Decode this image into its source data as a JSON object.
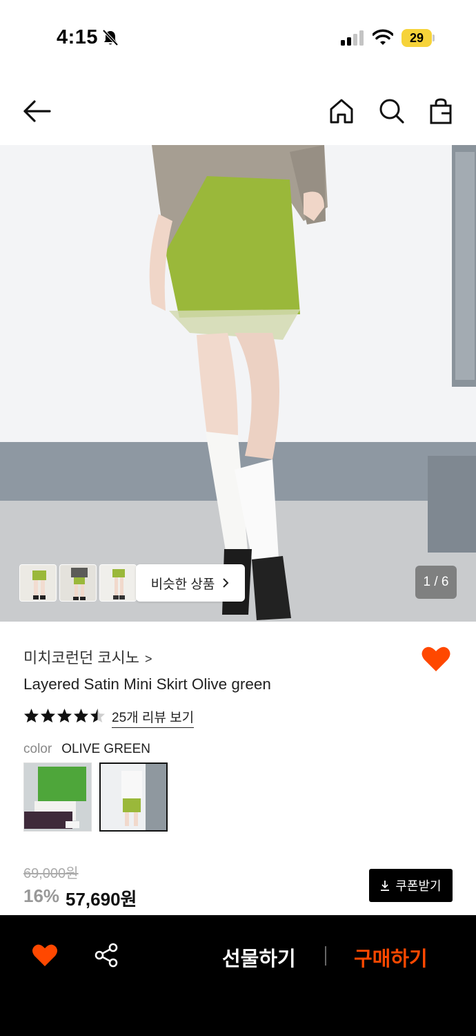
{
  "status_bar": {
    "time": "4:15",
    "battery": "29"
  },
  "nav": {
    "back": "arrow-left-icon",
    "home": "home-icon",
    "search": "search-icon",
    "bag": "shopping-bag-icon"
  },
  "gallery": {
    "similar_label": "비슷한 상품",
    "counter": "1 / 6"
  },
  "product": {
    "brand": "미치코런던 코시노",
    "brand_chevron": ">",
    "title": "Layered Satin Mini Skirt Olive green",
    "rating": 4.5,
    "review_link": "25개 리뷰 보기",
    "color_label": "color",
    "color_value": "OLIVE GREEN",
    "original_price": "69,000원",
    "discount": "16%",
    "final_price": "57,690원",
    "coupon_label": "쿠폰받기"
  },
  "bottom_bar": {
    "gift_label": "선물하기",
    "buy_label": "구매하기"
  },
  "colors": {
    "accent": "#ff4800",
    "battery": "#f6d33a",
    "skirt": "#9ab83a"
  }
}
